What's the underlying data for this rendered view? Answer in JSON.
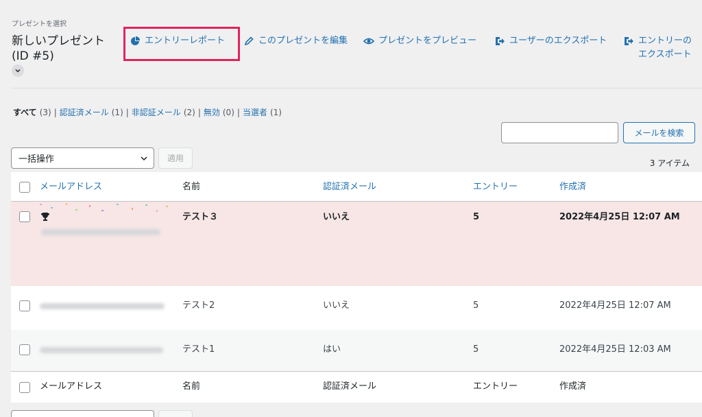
{
  "header": {
    "breadcrumb": "プレゼントを選択",
    "title": "新しいプレゼント (ID #5)"
  },
  "actions": [
    {
      "label": "エントリーレポート",
      "icon": "pie-chart-icon"
    },
    {
      "label": "このプレゼントを編集",
      "icon": "pencil-icon"
    },
    {
      "label": "プレゼントをプレビュー",
      "icon": "eye-icon"
    },
    {
      "label": "ユーザーのエクスポート",
      "icon": "export-icon"
    },
    {
      "label": "エントリーのエクスポート",
      "icon": "export-icon"
    }
  ],
  "filters": [
    {
      "label": "すべて",
      "count": "(3)",
      "current": true
    },
    {
      "label": "認証済メール",
      "count": "(1)"
    },
    {
      "label": "非認証メール",
      "count": "(2)"
    },
    {
      "label": "無効",
      "count": "(0)"
    },
    {
      "label": "当選者",
      "count": "(1)"
    }
  ],
  "search": {
    "button_label": "メールを検索",
    "value": ""
  },
  "bulk": {
    "selected": "一括操作",
    "apply_label": "適用"
  },
  "item_count": "3 アイテム",
  "columns": [
    "メールアドレス",
    "名前",
    "認証済メール",
    "エントリー",
    "作成済"
  ],
  "rows": [
    {
      "name": "テスト３",
      "verified": "いいえ",
      "entries": "5",
      "created": "2022年4月25日 12:07 AM",
      "winner": true
    },
    {
      "name": "テスト2",
      "verified": "いいえ",
      "entries": "5",
      "created": "2022年4月25日 12:07 AM"
    },
    {
      "name": "テスト1",
      "verified": "はい",
      "entries": "5",
      "created": "2022年4月25日 12:03 AM"
    }
  ],
  "colors": {
    "link": "#2271b1",
    "highlight": "#e0245e",
    "winner_row": "#f7e6e5"
  }
}
